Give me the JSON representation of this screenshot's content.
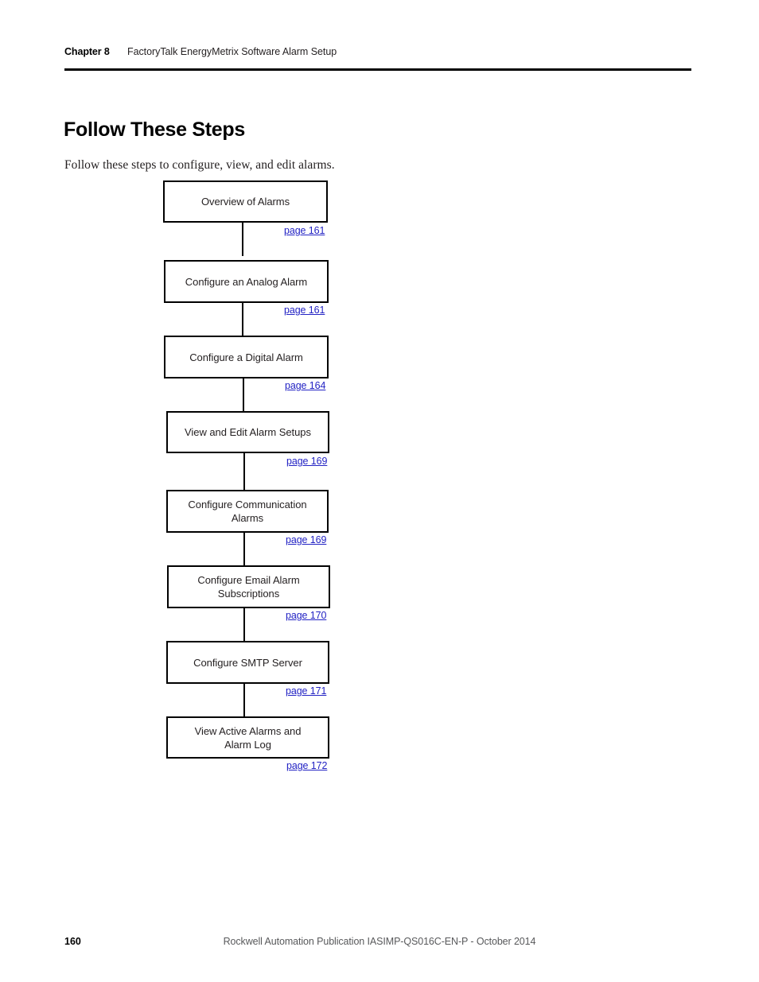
{
  "header": {
    "chapter_label": "Chapter 8",
    "chapter_title": "FactoryTalk EnergyMetrix Software Alarm Setup"
  },
  "section": {
    "title": "Follow These Steps",
    "intro": "Follow these steps to configure, view, and edit alarms."
  },
  "colors": {
    "link": "#2323c4",
    "text": "#231f20",
    "rule": "#000000"
  },
  "flowchart": {
    "steps": [
      {
        "label": "Overview of Alarms",
        "link": "page 161"
      },
      {
        "label": "Configure an Analog Alarm",
        "link": "page 161"
      },
      {
        "label": "Configure a Digital Alarm",
        "link": "page 164"
      },
      {
        "label": "View and Edit Alarm Setups",
        "link": "page 169"
      },
      {
        "label": "Configure Communication\nAlarms",
        "link": "page 169"
      },
      {
        "label": "Configure Email Alarm\nSubscriptions",
        "link": "page 170"
      },
      {
        "label": "Configure SMTP Server",
        "link": "page 171"
      },
      {
        "label": "View Active Alarms and\nAlarm Log",
        "link": "page 172"
      }
    ]
  },
  "footer": {
    "page_number": "160",
    "publication": "Rockwell Automation Publication IASIMP-QS016C-EN-P - October 2014"
  }
}
